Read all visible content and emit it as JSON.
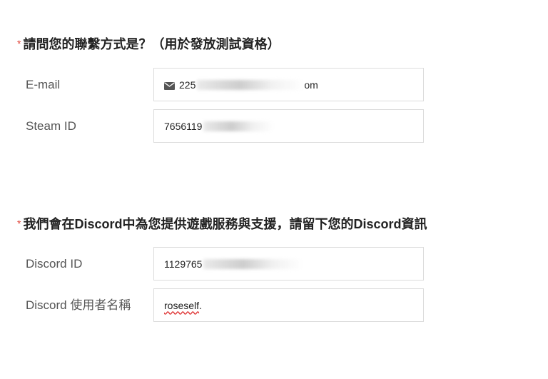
{
  "section1": {
    "required_mark": "*",
    "title": "請問您的聯繫方式是？（用於發放測試資格）",
    "email": {
      "label": "E-mail",
      "value": "225",
      "value_tail": "om",
      "icon": "mail-icon"
    },
    "steam": {
      "label": "Steam ID",
      "value": "7656119"
    }
  },
  "section2": {
    "required_mark": "*",
    "title": "我們會在Discord中為您提供遊戲服務與支援，請留下您的Discord資訊",
    "discord_id": {
      "label": "Discord ID",
      "value": "1129765"
    },
    "discord_name": {
      "label": "Discord 使用者名稱",
      "value_misspelled": "roseself",
      "value_suffix": "."
    }
  },
  "colors": {
    "required": "#e0453a",
    "border": "#dcdcdc",
    "spellcheck": "#e03a3a"
  }
}
